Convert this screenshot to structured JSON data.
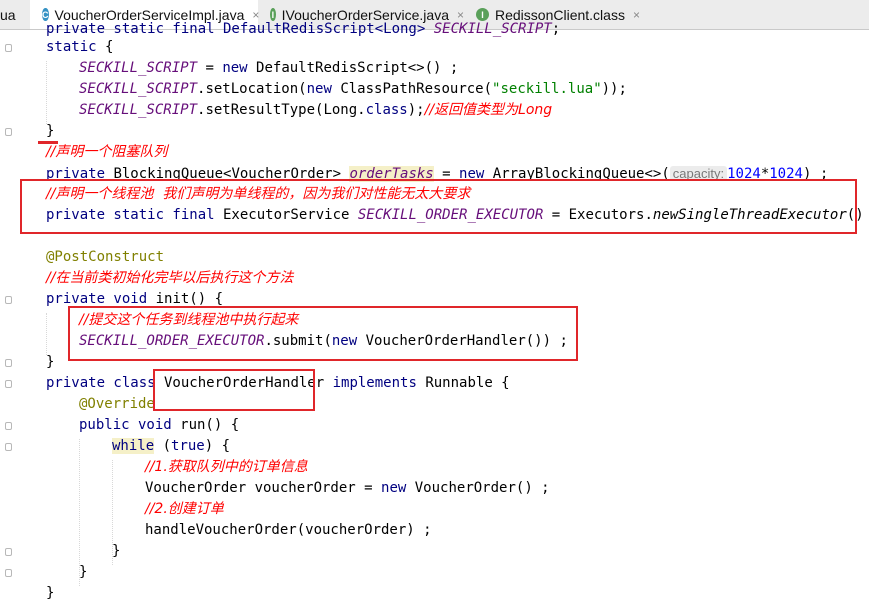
{
  "tabs": [
    {
      "label": "ua",
      "icon": "file-icon"
    },
    {
      "label": "VoucherOrderServiceImpl.java",
      "icon": "class-icon",
      "icon_letter": "C",
      "icon_color": "#3592c4",
      "active": true
    },
    {
      "label": "IVoucherOrderService.java",
      "icon": "interface-icon",
      "icon_letter": "I",
      "icon_color": "#5aa05a"
    },
    {
      "label": "RedissonClient.class",
      "icon": "interface-icon",
      "icon_letter": "I",
      "icon_color": "#5aa05a"
    }
  ],
  "close_glyph": "×",
  "code": {
    "l0": {
      "a": "private static final DefaultRedisScript<Long> ",
      "b": "SECKILL_SCRIPT",
      "c": ";"
    },
    "l1": {
      "a": "static",
      "b": " {"
    },
    "l2": {
      "a": "SECKILL_SCRIPT",
      "b": " = ",
      "c": "new",
      "d": " DefaultRedisScript<>() ;"
    },
    "l3": {
      "a": "SECKILL_SCRIPT",
      "b": ".setLocation(",
      "c": "new",
      "d": " ClassPathResource(",
      "e": "\"seckill.lua\"",
      "f": "));"
    },
    "l4": {
      "a": "SECKILL_SCRIPT",
      "b": ".setResultType(Long.",
      "c": "class",
      "d": ");",
      "e": "//返回值类型为Long"
    },
    "l5": {
      "a": "}"
    },
    "l6": {
      "a": "//声明一个阻塞队列"
    },
    "l7": {
      "a": "private",
      "b": " BlockingQueue<VoucherOrder> ",
      "c": "orderTasks",
      "d": " = ",
      "e": "new",
      "f": " ArrayBlockingQueue<>(",
      "g": "capacity:",
      "h": "1024",
      "i": "*",
      "j": "1024",
      "k": ") ;"
    },
    "l8": {
      "a": "//声明一个线程池  我们声明为单线程的，因为我们对性能无太大要求"
    },
    "l9": {
      "a": "private static final",
      "b": " ExecutorService ",
      "c": "SECKILL_ORDER_EXECUTOR",
      "d": " = Executors.",
      "e": "newSingleThreadExecutor",
      "f": "() ;"
    },
    "l10": {
      "a": "@PostConstruct"
    },
    "l11": {
      "a": "//在当前类初始化完毕以后执行这个方法"
    },
    "l12": {
      "a": "private void",
      "b": " init() {"
    },
    "l13": {
      "a": "//提交这个任务到线程池中执行起来"
    },
    "l14": {
      "a": "SECKILL_ORDER_EXECUTOR",
      "b": ".submit(",
      "c": "new",
      "d": " VoucherOrderHandler()) ;"
    },
    "l15": {
      "a": "}"
    },
    "l16": {
      "a": "private class",
      "b": " VoucherOrderHandler ",
      "c": "implements",
      "d": " Runnable {"
    },
    "l17": {
      "a": "@Override"
    },
    "l18": {
      "a": "public void",
      "b": " run() {"
    },
    "l19": {
      "a": "while",
      "b": " (",
      "c": "true",
      "d": ") {"
    },
    "l20": {
      "a": "//1.获取队列中的订单信息"
    },
    "l21": {
      "a": "VoucherOrder voucherOrder = ",
      "b": "new",
      "c": " VoucherOrder() ;"
    },
    "l22": {
      "a": "//2.创建订单"
    },
    "l23": {
      "a": "handleVoucherOrder(voucherOrder) ;"
    },
    "l24": {
      "a": "}"
    },
    "l25": {
      "a": "}"
    },
    "l26": {
      "a": "}"
    }
  },
  "colors": {
    "keyword": "#000080",
    "field": "#660e7a",
    "string": "#008000",
    "comment": "#ff0000",
    "annotation": "#808000",
    "number": "#0000ff",
    "highlight_box": "#e0262a"
  }
}
